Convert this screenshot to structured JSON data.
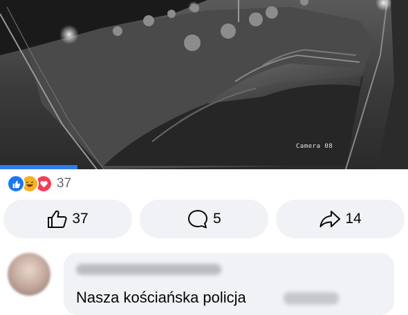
{
  "video": {
    "camera_label": "Camera 08",
    "progress_fraction": 0.19
  },
  "reactions": {
    "types": [
      "like",
      "haha",
      "love"
    ],
    "count": "37"
  },
  "actions": {
    "like_count": "37",
    "comment_count": "5",
    "share_count": "14"
  },
  "comment": {
    "text": "Nasza kościańska policja"
  },
  "colors": {
    "accent": "#1877f2",
    "progress": "#2d7cf0",
    "haha": "#f7b125",
    "love": "#f33e58",
    "button_bg": "#f0f2f5",
    "muted_text": "#65676b"
  }
}
